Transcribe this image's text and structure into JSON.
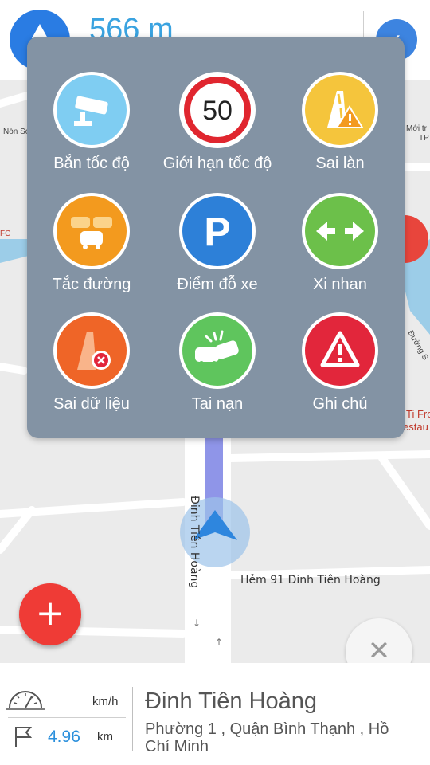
{
  "navigation": {
    "distance": "566 m",
    "back_symbol": "‹"
  },
  "map": {
    "labels": {
      "street_dinh_tien_hoang": "Đinh Tiên Hoàng",
      "street_hem_91": "Hẻm 91 Đinh Tiên Hoàng",
      "poi_non_scu": "Nón Scr",
      "poi_moi_truy": "Mới tr",
      "poi_tp": "TP",
      "poi_fc": "FC",
      "poi_ti_fro": "Ti Fro",
      "poi_restau": "estau",
      "poi_duong_s": "Đường S"
    }
  },
  "report_menu": {
    "items": [
      {
        "label": "Bắn tốc độ",
        "icon": "speed-camera-icon",
        "color": "#7fcdf2"
      },
      {
        "label": "Giới hạn tốc độ",
        "icon": "speed-limit-icon",
        "color": "#ffffff",
        "text": "50"
      },
      {
        "label": "Sai làn",
        "icon": "wrong-lane-icon",
        "color": "#f5c53c"
      },
      {
        "label": "Tắc đường",
        "icon": "traffic-jam-icon",
        "color": "#f39a1e"
      },
      {
        "label": "Điểm đỗ xe",
        "icon": "parking-icon",
        "color": "#2d80d8",
        "text": "P"
      },
      {
        "label": "Xi nhan",
        "icon": "turn-signal-icon",
        "color": "#6cc04a"
      },
      {
        "label": "Sai dữ liệu",
        "icon": "wrong-data-icon",
        "color": "#ef6527"
      },
      {
        "label": "Tai nạn",
        "icon": "accident-icon",
        "color": "#5fc55d"
      },
      {
        "label": "Ghi chú",
        "icon": "note-warning-icon",
        "color": "#e2263b"
      }
    ]
  },
  "buttons": {
    "add": "+",
    "close": "✕"
  },
  "info_panel": {
    "speed_unit": "km/h",
    "distance_value": "4.96",
    "distance_unit": "km",
    "street_name": "Đinh Tiên Hoàng",
    "address": "Phường 1 , Quận Bình Thạnh , Hồ Chí Minh"
  }
}
